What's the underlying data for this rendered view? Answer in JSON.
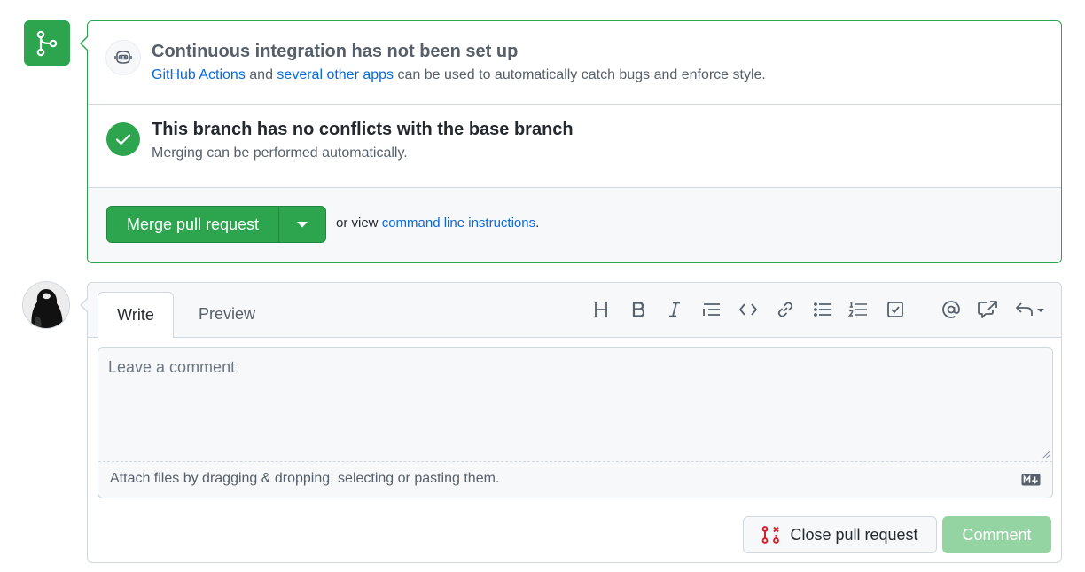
{
  "merge_panel": {
    "ci_title": "Continuous integration has not been set up",
    "ci_link1": "GitHub Actions",
    "ci_and": " and ",
    "ci_link2": "several other apps",
    "ci_rest": " can be used to automatically catch bugs and enforce style.",
    "conflict_title": "This branch has no conflicts with the base branch",
    "conflict_sub": "Merging can be performed automatically.",
    "merge_button": "Merge pull request",
    "or_view": "or view ",
    "cli_link": "command line instructions",
    "period": "."
  },
  "comment": {
    "tab_write": "Write",
    "tab_preview": "Preview",
    "toolbar_icons": [
      "heading-icon",
      "bold-icon",
      "italic-icon",
      "quote-icon",
      "code-icon",
      "link-icon",
      "unordered-list-icon",
      "ordered-list-icon",
      "task-list-icon",
      "mention-icon",
      "cross-reference-icon",
      "saved-reply-icon"
    ],
    "placeholder": "Leave a comment",
    "attach_text": "Attach files by dragging & dropping, selecting or pasting them.",
    "close_button": "Close pull request",
    "comment_button": "Comment"
  },
  "colors": {
    "success": "#2da44e",
    "link": "#0969da",
    "danger": "#cf222e",
    "disabled_green": "#94d3a2"
  }
}
